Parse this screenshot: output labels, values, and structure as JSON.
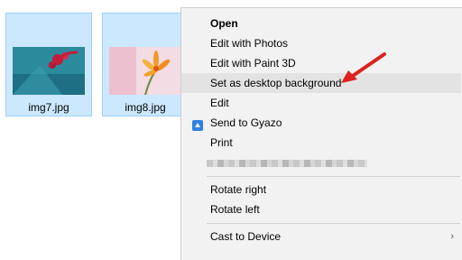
{
  "files": [
    {
      "name": "img7.jpg"
    },
    {
      "name": "img8.jpg"
    }
  ],
  "context_menu": {
    "items": [
      {
        "label": "Open",
        "bold": true
      },
      {
        "label": "Edit with Photos"
      },
      {
        "label": "Edit with Paint 3D"
      },
      {
        "label": "Set as desktop background",
        "highlighted": true
      },
      {
        "label": "Edit"
      },
      {
        "label": "Send to Gyazo",
        "icon": "gyazo-icon"
      },
      {
        "label": "Print"
      },
      {
        "label": "",
        "obscured": true
      },
      {
        "label": "Rotate right"
      },
      {
        "label": "Rotate left"
      },
      {
        "label": "Cast to Device",
        "submenu": true
      }
    ],
    "submenu_glyph": "›"
  },
  "colors": {
    "selection_bg": "#cce8ff",
    "menu_bg": "#f2f2f2",
    "arrow": "#e02020",
    "gyazo_blue": "#2f7fe6"
  }
}
